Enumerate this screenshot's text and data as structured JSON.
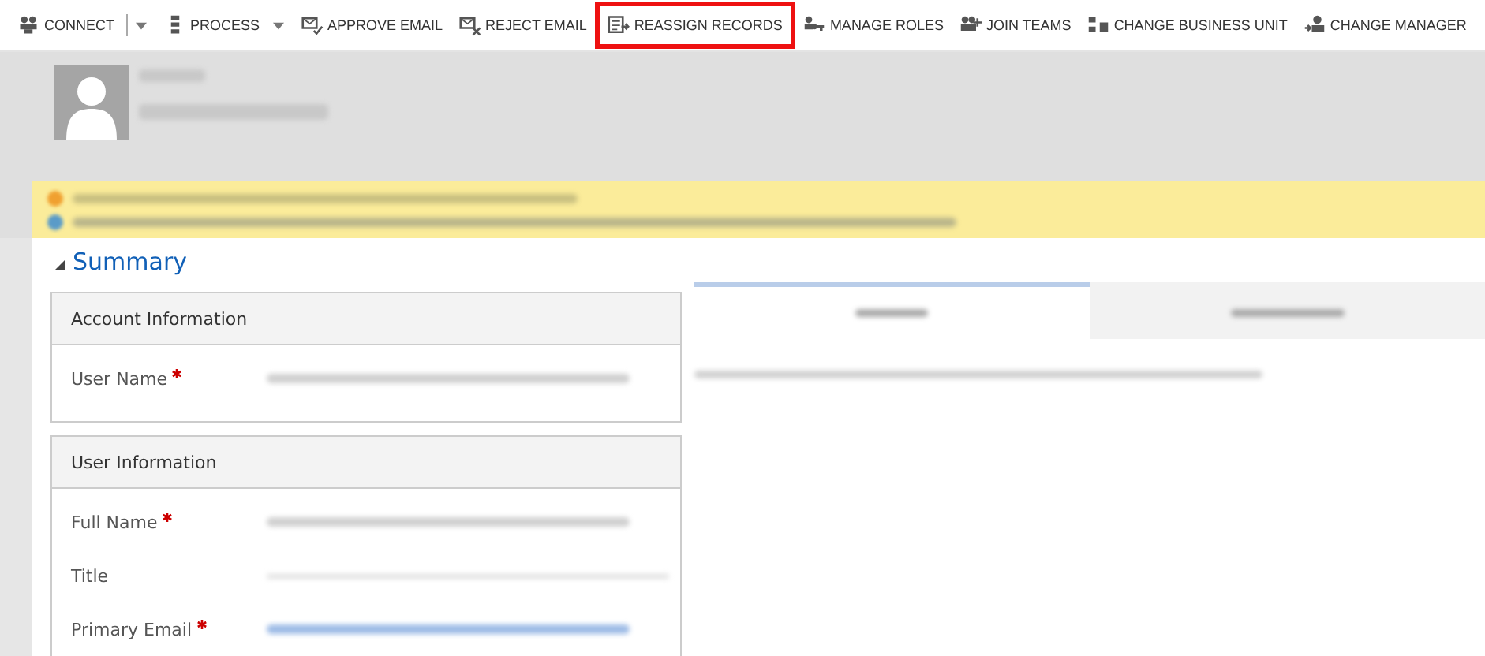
{
  "toolbar": [
    {
      "label": "CONNECT",
      "dropdown": true,
      "split": true,
      "highlighted": false
    },
    {
      "label": "PROCESS",
      "dropdown": true,
      "split": false,
      "highlighted": false
    },
    {
      "label": "APPROVE EMAIL",
      "dropdown": false,
      "split": false,
      "highlighted": false
    },
    {
      "label": "REJECT EMAIL",
      "dropdown": false,
      "split": false,
      "highlighted": false
    },
    {
      "label": "REASSIGN RECORDS",
      "dropdown": false,
      "split": false,
      "highlighted": true
    },
    {
      "label": "MANAGE ROLES",
      "dropdown": false,
      "split": false,
      "highlighted": false
    },
    {
      "label": "JOIN TEAMS",
      "dropdown": false,
      "split": false,
      "highlighted": false
    },
    {
      "label": "CHANGE BUSINESS UNIT",
      "dropdown": false,
      "split": false,
      "highlighted": false
    },
    {
      "label": "CHANGE MANAGER",
      "dropdown": false,
      "split": false,
      "highlighted": false
    }
  ],
  "section": {
    "title": "Summary",
    "expanded": true
  },
  "cards": [
    {
      "title": "Account Information",
      "fields": [
        {
          "label": "User Name",
          "required": true,
          "kind": "text"
        }
      ]
    },
    {
      "title": "User Information",
      "fields": [
        {
          "label": "Full Name",
          "required": true,
          "kind": "text"
        },
        {
          "label": "Title",
          "required": false,
          "kind": "line"
        },
        {
          "label": "Primary Email",
          "required": true,
          "kind": "link"
        }
      ]
    }
  ],
  "feed_tabs": [
    {
      "selected": true
    },
    {
      "selected": false
    }
  ]
}
